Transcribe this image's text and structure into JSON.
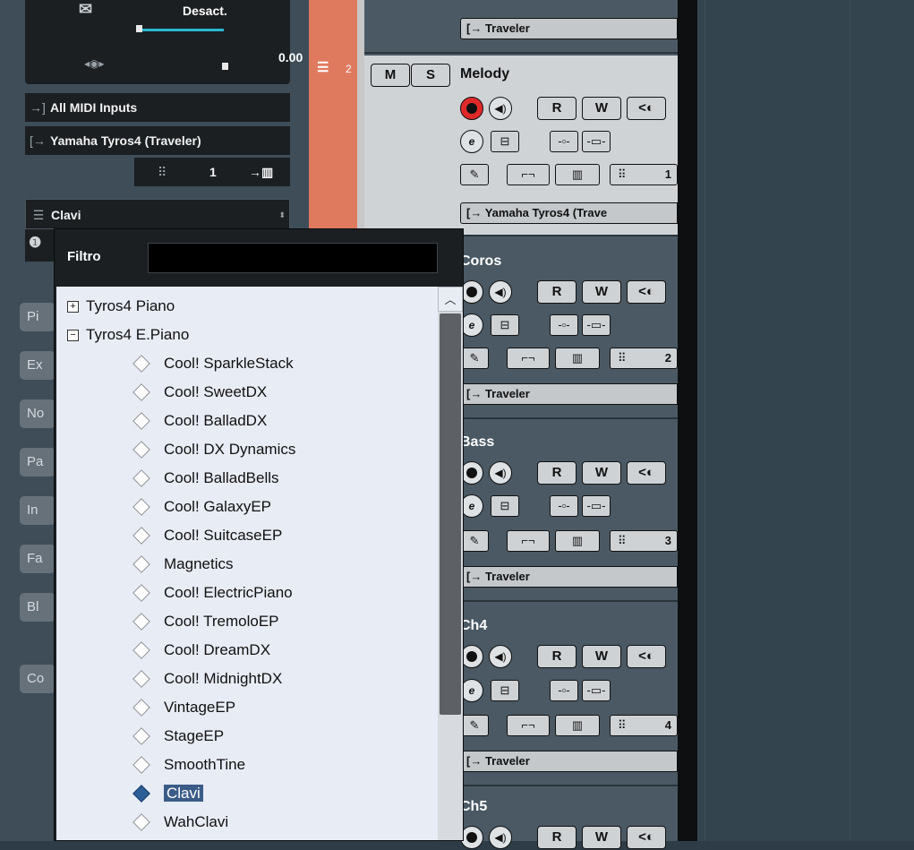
{
  "inspector": {
    "volume_label": "Desact.",
    "pan_value": "0.00",
    "midi_input": "All MIDI Inputs",
    "midi_output": "Yamaha Tyros4 (Traveler)",
    "channel": "1",
    "program": "Clavi",
    "side_buttons": [
      "Pi",
      "Ex",
      "No",
      "Pa",
      "In",
      "Fa",
      "Bl",
      "Co"
    ]
  },
  "tracks": [
    {
      "name": "",
      "number": "",
      "output": "Traveler",
      "channel": ""
    },
    {
      "name": "Melody",
      "number": "2",
      "output": "Yamaha Tyros4 (Trave",
      "channel": "1"
    },
    {
      "name": "Coros",
      "number": "",
      "output": "Traveler",
      "channel": "2"
    },
    {
      "name": "Bass",
      "number": "",
      "output": "Traveler",
      "channel": "3"
    },
    {
      "name": "Ch4",
      "number": "",
      "output": "Traveler",
      "channel": "4"
    },
    {
      "name": "Ch5",
      "number": "",
      "output": "",
      "channel": ""
    }
  ],
  "buttons": {
    "mute": "M",
    "solo": "S",
    "read": "R",
    "write": "W"
  },
  "popup": {
    "filter_label": "Filtro",
    "filter_value": "",
    "tree": [
      {
        "label": "Tyros4 Piano",
        "type": "group",
        "expanded": false
      },
      {
        "label": "Tyros4 E.Piano",
        "type": "group",
        "expanded": true
      },
      {
        "label": "Cool! SparkleStack",
        "type": "item"
      },
      {
        "label": "Cool! SweetDX",
        "type": "item"
      },
      {
        "label": "Cool! BalladDX",
        "type": "item"
      },
      {
        "label": "Cool! DX Dynamics",
        "type": "item"
      },
      {
        "label": "Cool! BalladBells",
        "type": "item"
      },
      {
        "label": "Cool! GalaxyEP",
        "type": "item"
      },
      {
        "label": "Cool! SuitcaseEP",
        "type": "item"
      },
      {
        "label": "Magnetics",
        "type": "item"
      },
      {
        "label": "Cool! ElectricPiano",
        "type": "item"
      },
      {
        "label": "Cool! TremoloEP",
        "type": "item"
      },
      {
        "label": "Cool! DreamDX",
        "type": "item"
      },
      {
        "label": "Cool! MidnightDX",
        "type": "item"
      },
      {
        "label": "VintageEP",
        "type": "item"
      },
      {
        "label": "StageEP",
        "type": "item"
      },
      {
        "label": "SmoothTine",
        "type": "item"
      },
      {
        "label": "Clavi",
        "type": "item",
        "selected": true
      },
      {
        "label": "WahClavi",
        "type": "item"
      }
    ]
  },
  "colors": {
    "track_selected": "#e07a5f",
    "record_active": "#e02a2a",
    "selection": "#3b5c88"
  }
}
